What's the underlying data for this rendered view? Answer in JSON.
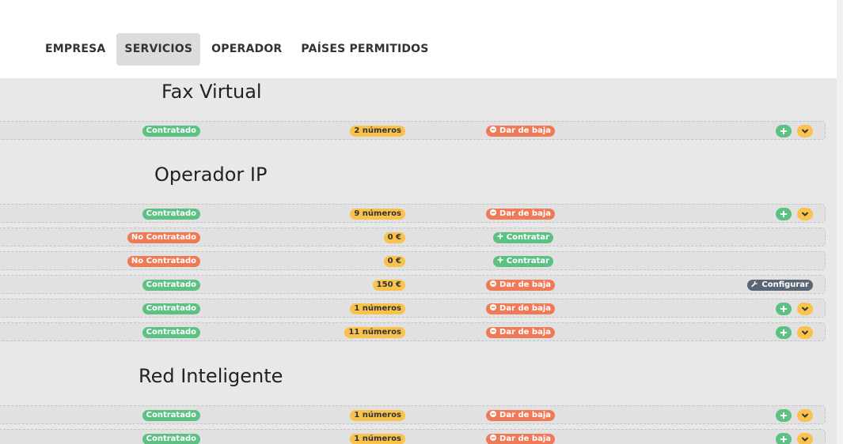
{
  "tabs": [
    {
      "label": "EMPRESA",
      "active": false
    },
    {
      "label": "SERVICIOS",
      "active": true
    },
    {
      "label": "OPERADOR",
      "active": false
    },
    {
      "label": "PAÍSES PERMITIDOS",
      "active": false
    }
  ],
  "sections": [
    {
      "title": "Fax Virtual",
      "rows": [
        {
          "status": "Contratado",
          "amount": "2 números",
          "action": "Dar de baja",
          "extra": "plus-chevron"
        }
      ]
    },
    {
      "title": "Operador IP",
      "rows": [
        {
          "status": "Contratado",
          "amount": "9 números",
          "action": "Dar de baja",
          "extra": "plus-chevron"
        },
        {
          "status": "No Contratado",
          "amount": "0 €",
          "action": "Contratar",
          "extra": "none"
        },
        {
          "status": "No Contratado",
          "amount": "0 €",
          "action": "Contratar",
          "extra": "none"
        },
        {
          "status": "Contratado",
          "amount": "150 €",
          "action": "Dar de baja",
          "extra": "configurar"
        },
        {
          "status": "Contratado",
          "amount": "1 números",
          "action": "Dar de baja",
          "extra": "plus-chevron"
        },
        {
          "status": "Contratado",
          "amount": "11 números",
          "action": "Dar de baja",
          "extra": "plus-chevron"
        }
      ]
    },
    {
      "title": "Red Inteligente",
      "rows": [
        {
          "status": "Contratado",
          "amount": "1 números",
          "action": "Dar de baja",
          "extra": "plus-chevron"
        },
        {
          "status": "Contratado",
          "amount": "1 números",
          "action": "Dar de baja",
          "extra": "plus-chevron"
        }
      ]
    }
  ],
  "configurar_label": "Configurar",
  "colors": {
    "green": "#5cc183",
    "red": "#ef7a58",
    "yellow": "#f9c24c",
    "gray": "#596673",
    "content_bg": "#e8e8e8"
  }
}
